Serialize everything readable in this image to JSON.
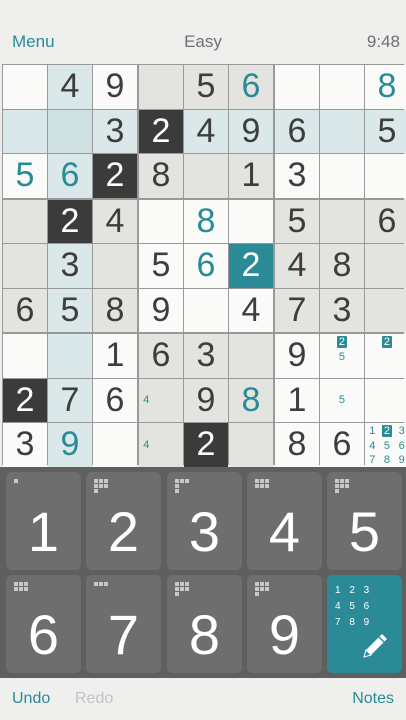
{
  "header": {
    "menu_label": "Menu",
    "difficulty": "Easy",
    "time": "9:48"
  },
  "colors": {
    "accent": "#2a8b96",
    "selected_dark": "#3b3b3b",
    "highlight_blue": "#dbe8ea",
    "cell_white": "#fafaf8",
    "cell_gray": "#e3e3e0"
  },
  "grid": [
    [
      {
        "v": "",
        "bg": "white"
      },
      {
        "v": "4",
        "bg": "blue"
      },
      {
        "v": "9",
        "bg": "white"
      },
      {
        "v": "",
        "bg": "gray"
      },
      {
        "v": "5",
        "bg": "gray"
      },
      {
        "v": "6",
        "bg": "gray",
        "user": true
      },
      {
        "v": "",
        "bg": "white"
      },
      {
        "v": "",
        "bg": "white"
      },
      {
        "v": "8",
        "bg": "white",
        "user": true
      }
    ],
    [
      {
        "v": "",
        "bg": "blue"
      },
      {
        "v": "",
        "bg": "blue2"
      },
      {
        "v": "3",
        "bg": "blue"
      },
      {
        "v": "2",
        "bg": "dark"
      },
      {
        "v": "4",
        "bg": "blue"
      },
      {
        "v": "9",
        "bg": "blue"
      },
      {
        "v": "6",
        "bg": "blue"
      },
      {
        "v": "",
        "bg": "blue"
      },
      {
        "v": "5",
        "bg": "blue"
      }
    ],
    [
      {
        "v": "5",
        "bg": "white",
        "user": true
      },
      {
        "v": "6",
        "bg": "blue",
        "user": true
      },
      {
        "v": "2",
        "bg": "dark"
      },
      {
        "v": "8",
        "bg": "gray"
      },
      {
        "v": "",
        "bg": "gray"
      },
      {
        "v": "1",
        "bg": "gray"
      },
      {
        "v": "3",
        "bg": "white"
      },
      {
        "v": "",
        "bg": "white"
      },
      {
        "v": "",
        "bg": "white"
      }
    ],
    [
      {
        "v": "",
        "bg": "gray"
      },
      {
        "v": "2",
        "bg": "dark"
      },
      {
        "v": "4",
        "bg": "gray"
      },
      {
        "v": "",
        "bg": "white"
      },
      {
        "v": "8",
        "bg": "white",
        "user": true
      },
      {
        "v": "",
        "bg": "white"
      },
      {
        "v": "5",
        "bg": "gray"
      },
      {
        "v": "",
        "bg": "gray"
      },
      {
        "v": "6",
        "bg": "gray"
      }
    ],
    [
      {
        "v": "",
        "bg": "gray"
      },
      {
        "v": "3",
        "bg": "blue"
      },
      {
        "v": "",
        "bg": "gray"
      },
      {
        "v": "5",
        "bg": "white"
      },
      {
        "v": "6",
        "bg": "white",
        "user": true
      },
      {
        "v": "2",
        "bg": "teal"
      },
      {
        "v": "4",
        "bg": "gray"
      },
      {
        "v": "8",
        "bg": "gray"
      },
      {
        "v": "",
        "bg": "gray"
      }
    ],
    [
      {
        "v": "6",
        "bg": "gray"
      },
      {
        "v": "5",
        "bg": "blue"
      },
      {
        "v": "8",
        "bg": "gray"
      },
      {
        "v": "9",
        "bg": "white"
      },
      {
        "v": "",
        "bg": "white"
      },
      {
        "v": "4",
        "bg": "white"
      },
      {
        "v": "7",
        "bg": "gray"
      },
      {
        "v": "3",
        "bg": "gray"
      },
      {
        "v": "",
        "bg": "gray"
      }
    ],
    [
      {
        "v": "",
        "bg": "white"
      },
      {
        "v": "",
        "bg": "blue"
      },
      {
        "v": "1",
        "bg": "white"
      },
      {
        "v": "6",
        "bg": "gray"
      },
      {
        "v": "3",
        "bg": "gray"
      },
      {
        "v": "",
        "bg": "gray"
      },
      {
        "v": "9",
        "bg": "white"
      },
      {
        "v": "",
        "bg": "white",
        "notes": [
          {
            "n": "2",
            "boxed": true,
            "pos": 1
          },
          {
            "n": "5",
            "pos": 4
          }
        ]
      },
      {
        "v": "",
        "bg": "white",
        "notes": [
          {
            "n": "2",
            "boxed": true,
            "pos": 1
          }
        ]
      }
    ],
    [
      {
        "v": "2",
        "bg": "dark"
      },
      {
        "v": "7",
        "bg": "blue"
      },
      {
        "v": "6",
        "bg": "white"
      },
      {
        "v": "",
        "bg": "gray",
        "notes": [
          {
            "n": "4",
            "pos": 3
          }
        ]
      },
      {
        "v": "9",
        "bg": "gray"
      },
      {
        "v": "8",
        "bg": "gray",
        "user": true
      },
      {
        "v": "1",
        "bg": "white"
      },
      {
        "v": "",
        "bg": "white",
        "notes": [
          {
            "n": "5",
            "pos": 4
          }
        ]
      },
      {
        "v": "",
        "bg": "white"
      }
    ],
    [
      {
        "v": "3",
        "bg": "white"
      },
      {
        "v": "9",
        "bg": "blue",
        "user": true
      },
      {
        "v": "",
        "bg": "white"
      },
      {
        "v": "",
        "bg": "gray",
        "notes": [
          {
            "n": "4",
            "pos": 3
          }
        ]
      },
      {
        "v": "2",
        "bg": "dark"
      },
      {
        "v": "",
        "bg": "gray"
      },
      {
        "v": "8",
        "bg": "white"
      },
      {
        "v": "6",
        "bg": "white"
      },
      {
        "v": "",
        "bg": "white",
        "notes": [
          {
            "n": "1",
            "pos": 0
          },
          {
            "n": "2",
            "boxed": true,
            "pos": 1
          },
          {
            "n": "3",
            "pos": 2
          },
          {
            "n": "4",
            "pos": 3
          },
          {
            "n": "5",
            "pos": 4
          },
          {
            "n": "6",
            "pos": 5
          },
          {
            "n": "7",
            "pos": 6
          },
          {
            "n": "8",
            "pos": 7
          },
          {
            "n": "9",
            "pos": 8
          }
        ]
      }
    ]
  ],
  "keypad": {
    "digits": [
      {
        "label": "1",
        "mini": [
          1,
          0,
          0,
          0,
          0,
          0,
          0,
          0,
          0
        ]
      },
      {
        "label": "2",
        "mini": [
          1,
          1,
          1,
          1,
          1,
          1,
          1,
          0,
          0
        ]
      },
      {
        "label": "3",
        "mini": [
          1,
          1,
          1,
          1,
          0,
          0,
          1,
          0,
          0
        ]
      },
      {
        "label": "4",
        "mini": [
          1,
          1,
          1,
          1,
          1,
          1,
          0,
          0,
          0
        ]
      },
      {
        "label": "5",
        "mini": [
          1,
          1,
          1,
          1,
          1,
          1,
          1,
          0,
          0
        ]
      },
      {
        "label": "6",
        "mini": [
          1,
          1,
          1,
          1,
          1,
          1,
          0,
          0,
          0
        ]
      },
      {
        "label": "7",
        "mini": [
          1,
          1,
          1,
          0,
          0,
          0,
          0,
          0,
          0
        ]
      },
      {
        "label": "8",
        "mini": [
          1,
          1,
          1,
          1,
          1,
          1,
          1,
          0,
          0
        ]
      },
      {
        "label": "9",
        "mini": [
          1,
          1,
          1,
          1,
          1,
          1,
          1,
          0,
          0
        ]
      }
    ],
    "notes_grid": [
      "1 2 3",
      "4 5 6",
      "7 8 9"
    ],
    "notes_icon": "pencil-icon"
  },
  "footer": {
    "undo_label": "Undo",
    "redo_label": "Redo",
    "notes_label": "Notes"
  }
}
